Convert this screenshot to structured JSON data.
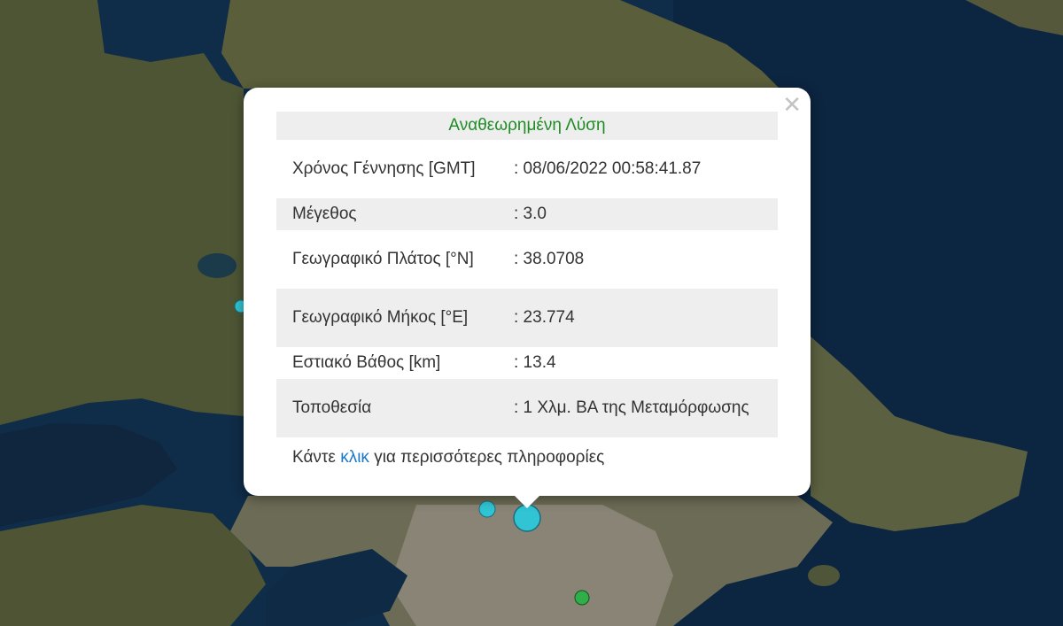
{
  "popup": {
    "close_glyph": "✕",
    "title": "Αναθεωρημένη Λύση",
    "rows": [
      {
        "label": "Χρόνος Γέννησης [GMT]",
        "value": ": 08/06/2022 00:58:41.87"
      },
      {
        "label": "Μέγεθος",
        "value": ": 3.0"
      },
      {
        "label": "Γεωγραφικό Πλάτος [°N]",
        "value": ": 38.0708"
      },
      {
        "label": "Γεωγραφικό Μήκος [°E]",
        "value": ": 23.774"
      },
      {
        "label": "Εστιακό Βάθος [km]",
        "value": ": 13.4"
      },
      {
        "label": "Τοποθεσία",
        "value": ": 1 Χλμ. ΒΑ της Μεταμόρφωσης"
      }
    ],
    "more_prefix": "Κάντε ",
    "more_link": "κλικ",
    "more_suffix": " για περισσότερες πληροφορίες"
  },
  "colors": {
    "title_green": "#1e8c24",
    "link_blue": "#1a78c8",
    "marker_cyan": "#30c4d4",
    "marker_green": "#2fae4a",
    "sea": "#0d2a45",
    "land": "#5a5f3c"
  }
}
